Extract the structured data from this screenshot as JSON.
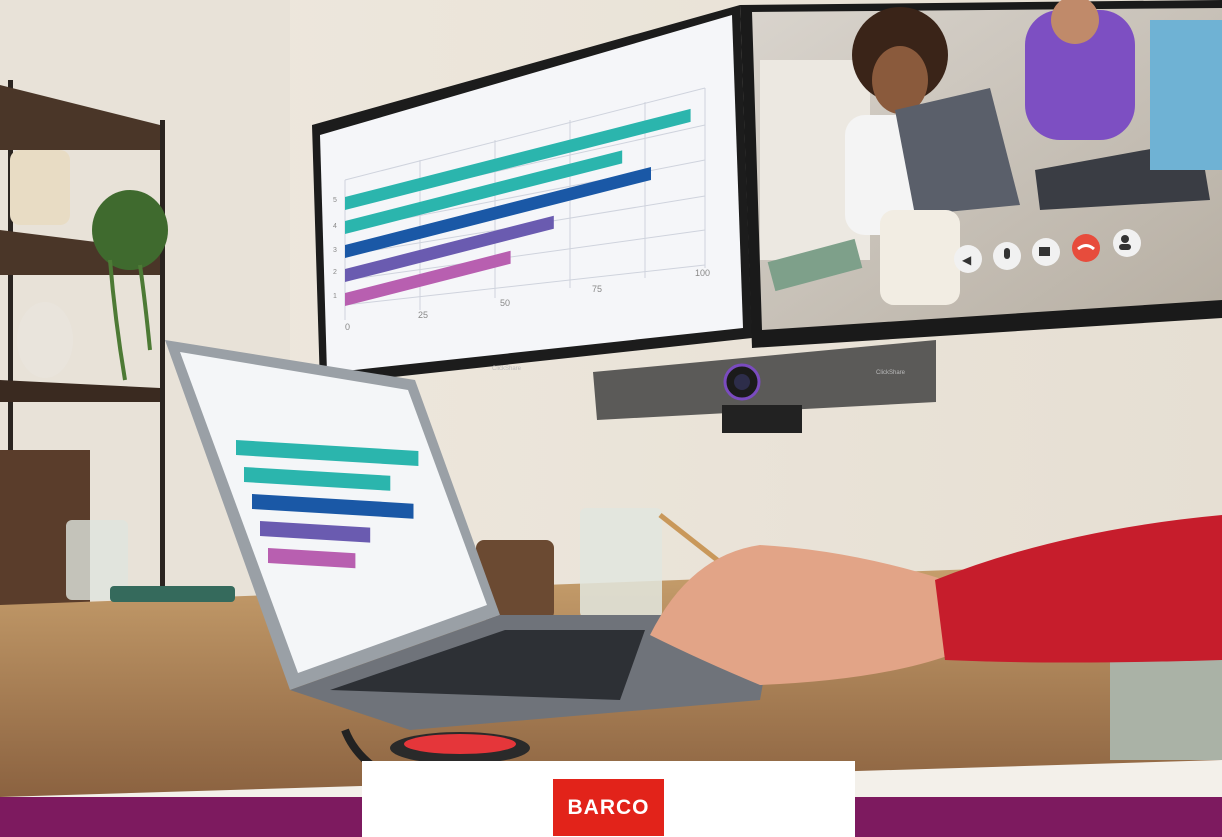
{
  "photo": {
    "presentation_chart": {
      "type": "bar",
      "series": [
        {
          "value": 96,
          "color": "#2bb5ad"
        },
        {
          "value": 77,
          "color": "#2bb5ad"
        },
        {
          "value": 85,
          "color": "#1a58a6"
        },
        {
          "value": 58,
          "color": "#6a5bb0"
        },
        {
          "value": 46,
          "color": "#b85fb0"
        }
      ],
      "xticks": [
        "0",
        "25",
        "50",
        "75",
        "100"
      ],
      "yticks": [
        "5",
        "4",
        "3",
        "2",
        "1"
      ]
    },
    "call_controls": [
      "speaker-icon",
      "microphone-icon",
      "camera-icon",
      "hang-up-icon",
      "participants-icon"
    ],
    "screen_brand": "ClickShare",
    "bar_brand": "ClickShare"
  },
  "brand": {
    "logo_text": "BARCO",
    "logo_color": "#e2231a",
    "band_color": "#7d1a5f"
  }
}
